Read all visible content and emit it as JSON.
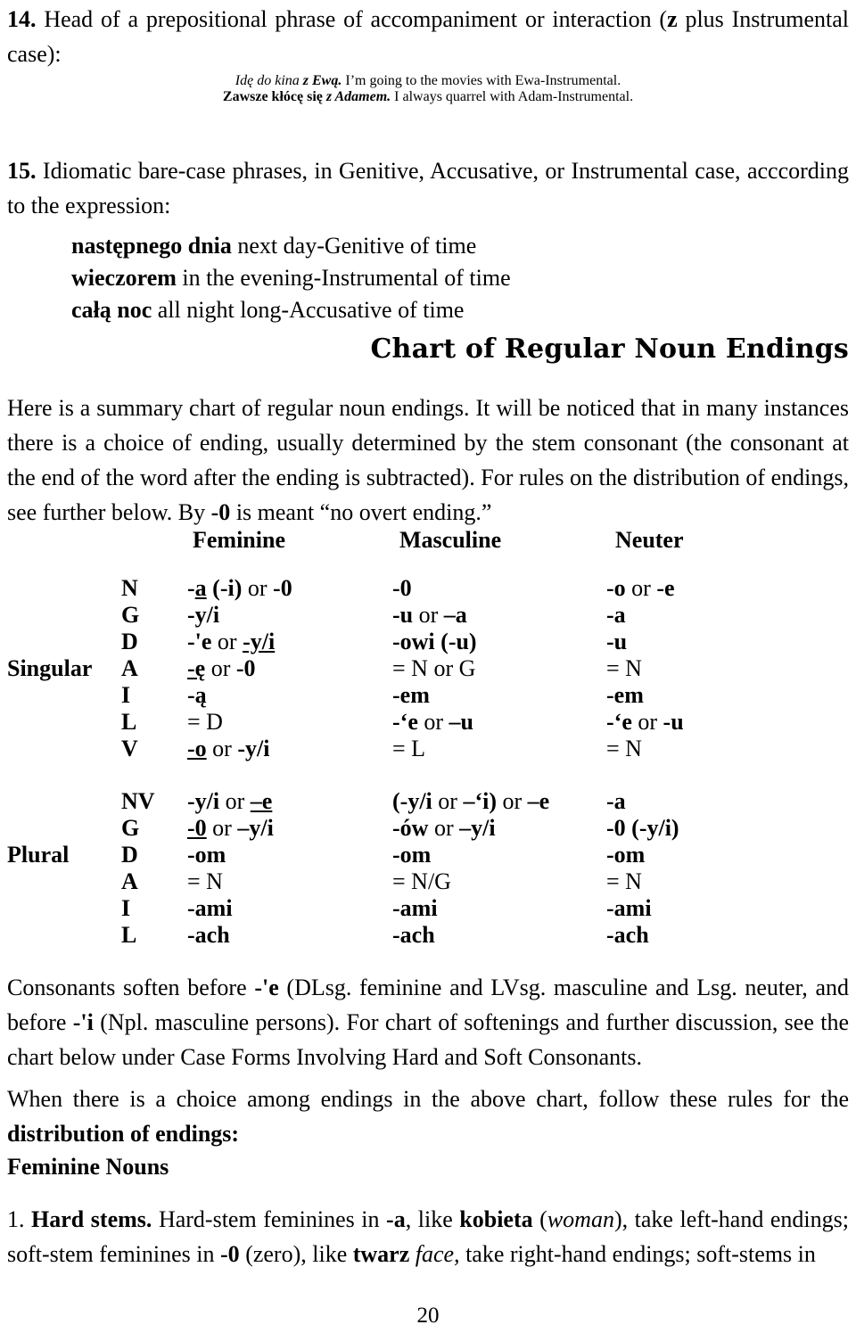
{
  "document": {
    "page_number": "20"
  },
  "item14": {
    "number": "14.",
    "text_before_z": "Head of a prepositional phrase of accompaniment or interaction (",
    "z": "z",
    "text_after_z": " plus Instrumental case):",
    "examples": [
      {
        "polish": "Idę do kina z Ewą.",
        "polish_plain": "Idę do kina ",
        "polish_bold": "z Ewą.",
        "english": " I’m going to the movies with Ewa-Instrumental."
      },
      {
        "polish_plain": "Zawsze kłócę się ",
        "polish_bold": "z Adamem.",
        "english": " I always quarrel with Adam-Instrumental."
      }
    ]
  },
  "item15": {
    "number": "15.",
    "text": "Idiomatic bare-case phrases, in Genitive, Accusative, or Instrumental case, acccording to the expression:",
    "examples": [
      {
        "bold": "następnego dnia",
        "rest": " next day-Genitive of time"
      },
      {
        "bold": "wieczorem",
        "rest": " in the evening-Instrumental of time"
      },
      {
        "bold": "całą noc",
        "rest": " all night long-Accusative of time"
      }
    ]
  },
  "chart": {
    "heading": "Chart of Regular Noun Endings",
    "intro_1": "Here is a summary chart of regular noun endings. It will be noticed that in many instances there is a choice of ending, usually determined by the stem consonant (the consonant at the end of the word after the ending is subtracted). For rules on the distribution of endings, see further below. By ",
    "intro_zero": "-0",
    "intro_2": " is meant “no overt ending.”"
  },
  "table": {
    "columns": [
      "Feminine",
      "Masculine",
      "Neuter"
    ],
    "singular_label": "Singular",
    "plural_label": "Plural",
    "singular_rows": [
      {
        "case": "N",
        "feminine": "-a (-i) or -0",
        "masculine": "-0",
        "neuter": "-o or -e"
      },
      {
        "case": "G",
        "feminine": "-y/i",
        "masculine": "-u or –a",
        "neuter": "-a"
      },
      {
        "case": "D",
        "feminine": "-'e or -y/i",
        "masculine": "-owi (-u)",
        "neuter": "-u"
      },
      {
        "case": "A",
        "feminine": "-ę or -0",
        "masculine": "= N or G",
        "neuter": "= N"
      },
      {
        "case": "I",
        "feminine": "-ą",
        "masculine": "-em",
        "neuter": "-em"
      },
      {
        "case": "L",
        "feminine": "= D",
        "masculine": "-‘e or –u",
        "neuter": "-‘e or -u"
      },
      {
        "case": "V",
        "feminine": "-o or -y/i",
        "masculine": "= L",
        "neuter": "= N"
      }
    ],
    "plural_rows": [
      {
        "case": "NV",
        "feminine": "-y/i or –e",
        "masculine": "(-y/i or –‘i) or –e",
        "neuter": "-a"
      },
      {
        "case": "G",
        "feminine": "-0 or –y/i",
        "masculine": "-ów or –y/i",
        "neuter": "-0 (-y/i)"
      },
      {
        "case": "D",
        "feminine": "-om",
        "masculine": "-om",
        "neuter": "-om"
      },
      {
        "case": "A",
        "feminine": "= N",
        "masculine": "= N/G",
        "neuter": "= N"
      },
      {
        "case": "I",
        "feminine": "-ami",
        "masculine": "-ami",
        "neuter": "-ami"
      },
      {
        "case": "L",
        "feminine": "-ach",
        "masculine": "-ach",
        "neuter": "-ach"
      }
    ]
  },
  "notes": {
    "soften_1": "Consonants soften before ",
    "soften_e": "-'e",
    "soften_2": " (DLsg. feminine and LVsg. masculine and Lsg. neuter, and before ",
    "soften_i": "-'i",
    "soften_3": " (Npl. masculine persons). For chart of softenings and further discussion, see the chart below under Case Forms Involving Hard and Soft Consonants.",
    "choice_1": "When there is a choice among endings in the above chart, follow these rules for the ",
    "choice_bold": "distribution of endings:",
    "feminine_nouns_heading": "Feminine Nouns",
    "hard_stems_num": "1. ",
    "hard_stems_bold": "Hard stems.",
    "hard_stems_1": " Hard-stem feminines in ",
    "hard_stems_a": "-a",
    "hard_stems_2": ", like ",
    "hard_stems_kobieta": "kobieta",
    "hard_stems_3": " (",
    "hard_stems_woman": "woman",
    "hard_stems_4": "), take left-hand endings; soft-stem feminines in ",
    "hard_stems_zero": "-0",
    "hard_stems_5": " (zero), like ",
    "hard_stems_twarz": "twarz",
    "hard_stems_face": " face,",
    "hard_stems_6": " take right-hand endings; soft-stems in"
  }
}
